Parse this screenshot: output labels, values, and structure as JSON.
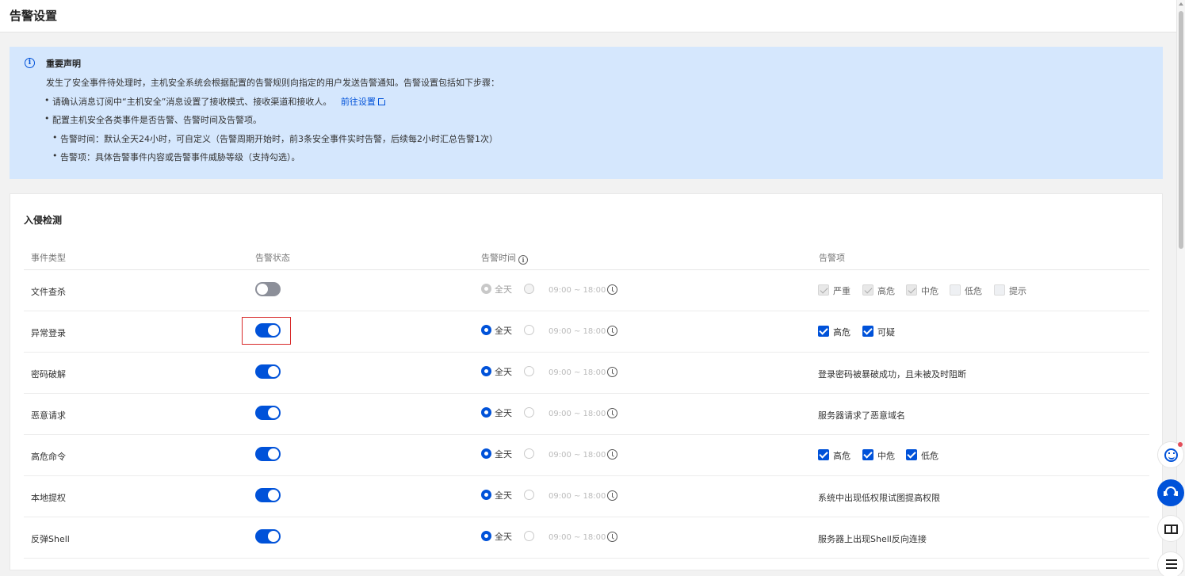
{
  "header": {
    "title": "告警设置"
  },
  "notice": {
    "title": "重要声明",
    "intro": "发生了安全事件待处理时，主机安全系统会根据配置的告警规则向指定的用户发送告警通知。告警设置包括如下步骤：",
    "step1": "请确认消息订阅中“主机安全”消息设置了接收模式、接收渠道和接收人。",
    "step1_link": "前往设置",
    "step2": "配置主机安全各类事件是否告警、告警时间及告警项。",
    "sub1": "告警时间：默认全天24小时，可自定义（告警周期开始时，前3条安全事件实时告警，后续每2小时汇总告警1次）",
    "sub2": "告警项：具体告警事件内容或告警事件威胁等级（支持勾选）。"
  },
  "section": {
    "title": "入侵检测",
    "columns": {
      "type": "事件类型",
      "status": "告警状态",
      "time": "告警时间",
      "items": "告警项"
    }
  },
  "time": {
    "all_day": "全天",
    "range": "09:00 ~ 18:00"
  },
  "rows": [
    {
      "name": "文件查杀",
      "enabled": false,
      "checkboxes": [
        "严重",
        "高危",
        "中危",
        "低危",
        "提示"
      ]
    },
    {
      "name": "异常登录",
      "enabled": true,
      "checkboxes": [
        "高危",
        "可疑"
      ]
    },
    {
      "name": "密码破解",
      "enabled": true,
      "description": "登录密码被暴破成功，且未被及时阻断"
    },
    {
      "name": "恶意请求",
      "enabled": true,
      "description": "服务器请求了恶意域名"
    },
    {
      "name": "高危命令",
      "enabled": true,
      "checkboxes": [
        "高危",
        "中危",
        "低危"
      ]
    },
    {
      "name": "本地提权",
      "enabled": true,
      "description": "系统中出现低权限试图提高权限"
    },
    {
      "name": "反弹Shell",
      "enabled": true,
      "description": "服务器上出现Shell反向连接"
    }
  ],
  "colors": {
    "primary": "#0052d9",
    "notice_bg": "#d5e7fd",
    "highlight": "#d82a2a"
  }
}
